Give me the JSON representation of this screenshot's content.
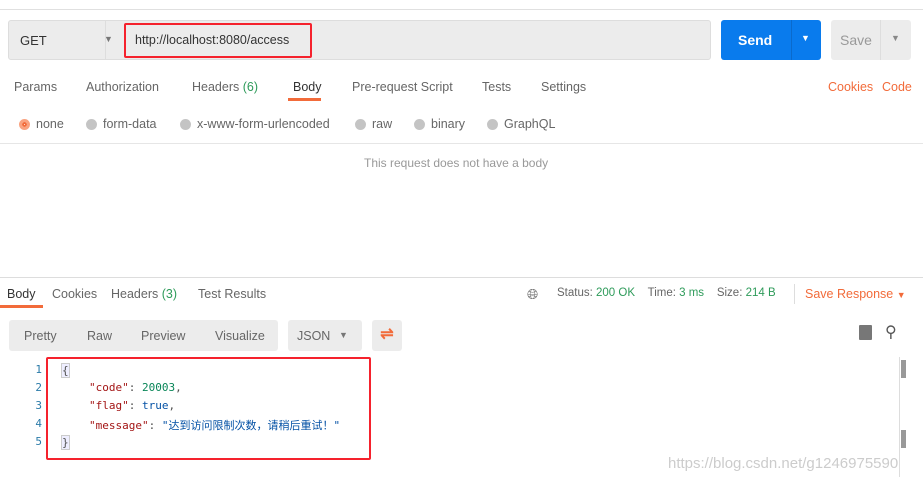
{
  "request": {
    "method": "GET",
    "url": "http://localhost:8080/access",
    "send": "Send",
    "save": "Save"
  },
  "req_tabs": [
    "Params",
    "Authorization",
    "Headers",
    "(6)",
    "Body",
    "Pre-request Script",
    "Tests",
    "Settings"
  ],
  "links": {
    "cookies": "Cookies",
    "code": "Code"
  },
  "body_types": [
    "none",
    "form-data",
    "x-www-form-urlencoded",
    "raw",
    "binary",
    "GraphQL"
  ],
  "no_body": "This request does not have a body",
  "resp_tabs": [
    "Body",
    "Cookies",
    "Headers",
    "(3)",
    "Test Results"
  ],
  "status": {
    "status_label": "Status:",
    "status": "200 OK",
    "time_label": "Time:",
    "time": "3 ms",
    "size_label": "Size:",
    "size": "214 B",
    "save_response": "Save Response"
  },
  "view": [
    "Pretty",
    "Raw",
    "Preview",
    "Visualize"
  ],
  "format": "JSON",
  "json": {
    "l1": "{",
    "k1": "\"code\"",
    "v1": "20003",
    "k2": "\"flag\"",
    "v2": "true",
    "k3": "\"message\"",
    "v3": "\"达到访问限制次数，请稍后重试！\"",
    "l5": "}"
  },
  "watermark": "https://blog.csdn.net/g1246975590"
}
